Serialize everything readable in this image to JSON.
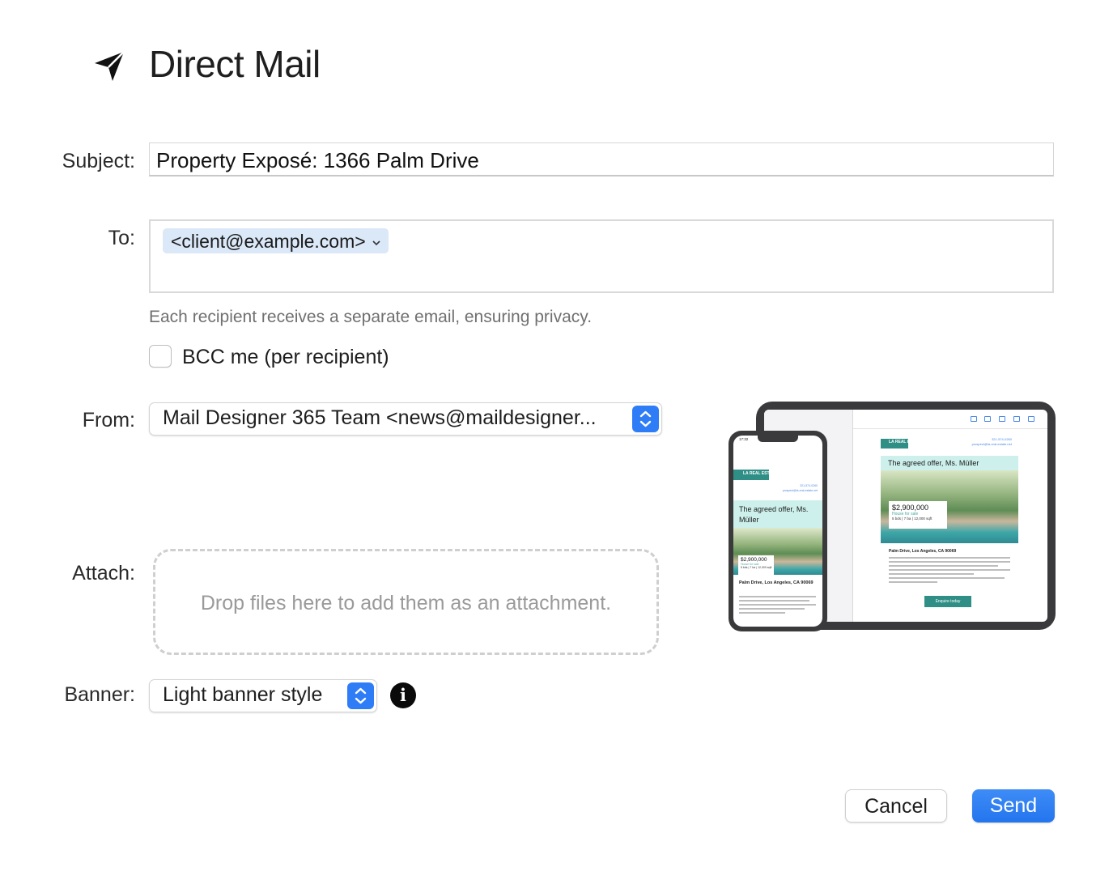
{
  "header": {
    "title": "Direct Mail",
    "icon": "paper-plane-icon"
  },
  "form": {
    "subject_label": "Subject:",
    "subject_value": "Property Exposé: 1366 Palm Drive",
    "to_label": "To:",
    "to_recipient": "<client@example.com>",
    "privacy_hint": "Each recipient receives a separate email, ensuring privacy.",
    "bcc_label": "BCC me (per recipient)",
    "bcc_checked": false,
    "from_label": "From:",
    "from_value": "Mail Designer 365 Team <news@maildesigner...",
    "attach_label": "Attach:",
    "attach_placeholder": "Drop files here to add them as an attachment.",
    "banner_label": "Banner:",
    "banner_value": "Light banner style"
  },
  "preview": {
    "phone_time": "17:32",
    "logo": "LA REAL ESTATE",
    "phone_number": "321-574-0260",
    "email": "prospect@la-real-estate.net",
    "offer_title": "The agreed offer, Ms. Müller",
    "price": "$2,900,000",
    "status": "House for sale",
    "specs": "5 bds | 7 ba | 12,000 sqft",
    "tablet_address": "Palm Drive, Los Angeles, CA 90069",
    "phone_address": "Palm Drive, Los Angeles, CA 90069",
    "cta": "Enquire today"
  },
  "buttons": {
    "cancel": "Cancel",
    "send": "Send"
  },
  "colors": {
    "accent": "#2b7ef5",
    "teal": "#2f8f86",
    "mint": "#cdf0ec"
  }
}
